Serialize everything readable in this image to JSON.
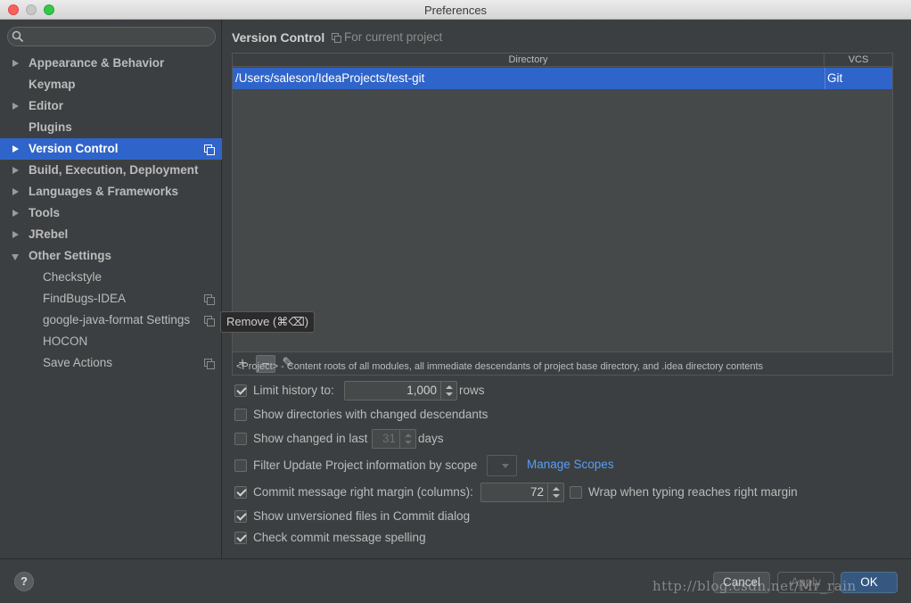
{
  "window": {
    "title": "Preferences"
  },
  "sidebar": {
    "search_placeholder": "",
    "items": [
      {
        "label": "Appearance & Behavior"
      },
      {
        "label": "Keymap"
      },
      {
        "label": "Editor"
      },
      {
        "label": "Plugins"
      },
      {
        "label": "Version Control"
      },
      {
        "label": "Build, Execution, Deployment"
      },
      {
        "label": "Languages & Frameworks"
      },
      {
        "label": "Tools"
      },
      {
        "label": "JRebel"
      },
      {
        "label": "Other Settings"
      },
      {
        "label": "Checkstyle"
      },
      {
        "label": "FindBugs-IDEA"
      },
      {
        "label": "google-java-format Settings"
      },
      {
        "label": "HOCON"
      },
      {
        "label": "Save Actions"
      }
    ]
  },
  "main": {
    "heading": "Version Control",
    "scope_note": "For current project",
    "table": {
      "columns": [
        "Directory",
        "VCS"
      ],
      "rows": [
        {
          "directory": "/Users/saleson/IdeaProjects/test-git",
          "vcs": "Git"
        }
      ]
    },
    "toolbar": {
      "add": "+",
      "remove": "−",
      "edit": "✎"
    },
    "tooltip": "Remove (⌘⌫)",
    "note": "<Project> - Content roots of all modules, all immediate descendants of project base directory, and .idea directory contents",
    "options": {
      "limit_history": {
        "label": "Limit history to:",
        "value": "1,000",
        "suffix": "rows",
        "checked": true
      },
      "show_dirs": {
        "label": "Show directories with changed descendants",
        "checked": false
      },
      "show_changed": {
        "label": "Show changed in last",
        "value": "31",
        "suffix": "days",
        "checked": false
      },
      "filter_update": {
        "label": "Filter Update Project information by scope",
        "checked": false,
        "link": "Manage Scopes"
      },
      "commit_margin": {
        "label": "Commit message right margin (columns):",
        "value": "72",
        "checked": true
      },
      "wrap_typing": {
        "label": "Wrap when typing reaches right margin",
        "checked": false
      },
      "show_unversioned": {
        "label": "Show unversioned files in Commit dialog",
        "checked": true
      },
      "check_spelling": {
        "label": "Check commit message spelling",
        "checked": true
      }
    }
  },
  "footer": {
    "help": "?",
    "cancel": "Cancel",
    "apply": "Apply",
    "ok": "OK",
    "watermark": "http://blog.csdn.net/Mr_rain"
  }
}
